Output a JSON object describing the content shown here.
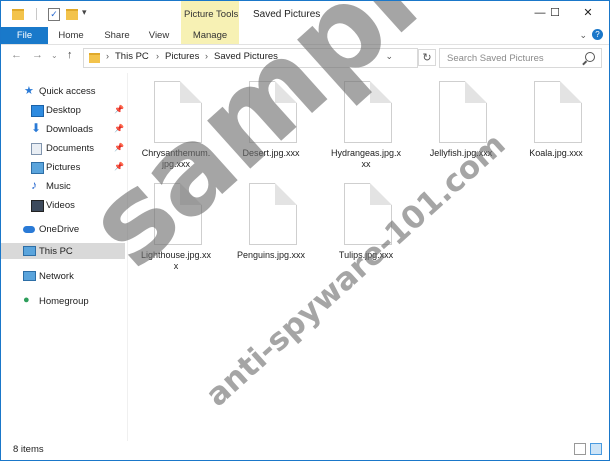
{
  "window": {
    "title": "Saved Pictures",
    "context_tab": "Picture Tools",
    "controls": {
      "minimize": "—",
      "maximize": "☐",
      "close": "✕"
    }
  },
  "ribbon": {
    "tabs": [
      "File",
      "Home",
      "Share",
      "View",
      "Manage"
    ],
    "help": "?"
  },
  "address": {
    "crumbs": [
      "This PC",
      "Pictures",
      "Saved Pictures"
    ]
  },
  "search": {
    "placeholder": "Search Saved Pictures"
  },
  "sidebar": {
    "items": [
      {
        "label": "Quick access",
        "icon": "star-icon"
      },
      {
        "label": "Desktop",
        "icon": "desktop-icon",
        "pinned": true
      },
      {
        "label": "Downloads",
        "icon": "download-icon",
        "pinned": true
      },
      {
        "label": "Documents",
        "icon": "documents-icon",
        "pinned": true
      },
      {
        "label": "Pictures",
        "icon": "pictures-icon",
        "pinned": true
      },
      {
        "label": "Music",
        "icon": "music-icon"
      },
      {
        "label": "Videos",
        "icon": "videos-icon"
      },
      {
        "label": "OneDrive",
        "icon": "onedrive-icon"
      },
      {
        "label": "This PC",
        "icon": "pc-icon",
        "selected": true
      },
      {
        "label": "Network",
        "icon": "network-icon"
      },
      {
        "label": "Homegroup",
        "icon": "homegroup-icon"
      }
    ]
  },
  "files": [
    {
      "name": "Chrysanthemum.\njpg.xxx"
    },
    {
      "name": "Desert.jpg.xxx"
    },
    {
      "name": "Hydrangeas.jpg.x\nxx"
    },
    {
      "name": "Jellyfish.jpg.xxx"
    },
    {
      "name": "Koala.jpg.xxx"
    },
    {
      "name": "Lighthouse.jpg.xx\nx"
    },
    {
      "name": "Penguins.jpg.xxx"
    },
    {
      "name": "Tulips.jpg.xxx"
    }
  ],
  "status": {
    "item_count": "8 items"
  },
  "watermark": {
    "main": "sample",
    "sub": "anti-spyware-101.com"
  },
  "colors": {
    "accent": "#1979ca",
    "context_tab": "#f7f1b4",
    "selected": "#d9d9d9"
  }
}
